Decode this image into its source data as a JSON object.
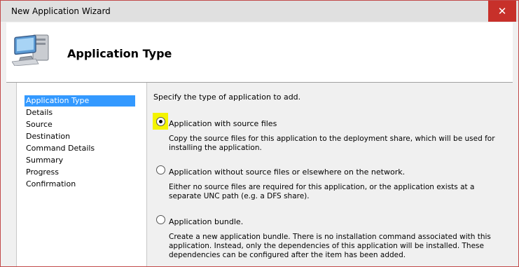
{
  "window": {
    "title": "New Application Wizard",
    "close_label": "✕"
  },
  "header": {
    "title": "Application Type",
    "icon": "computer-icon"
  },
  "nav": {
    "items": [
      {
        "label": "Application Type",
        "selected": true
      },
      {
        "label": "Details"
      },
      {
        "label": "Source"
      },
      {
        "label": "Destination"
      },
      {
        "label": "Command Details"
      },
      {
        "label": "Summary"
      },
      {
        "label": "Progress"
      },
      {
        "label": "Confirmation"
      }
    ]
  },
  "content": {
    "intro": "Specify the type of application to add.",
    "options": [
      {
        "label": "Application with source files",
        "description": "Copy the source files for this application to the deployment share, which will be used for installing the application.",
        "checked": true
      },
      {
        "label": "Application without source files or elsewhere on the network.",
        "description": "Either no source files are required for this application, or the application exists at a separate UNC path (e.g. a DFS share).",
        "checked": false
      },
      {
        "label": "Application bundle.",
        "description": "Create a new application bundle.  There is no installation command associated with this application.  Instead, only the dependencies of this application will be installed.  These dependencies can be configured after the item has been added.",
        "checked": false
      }
    ]
  }
}
